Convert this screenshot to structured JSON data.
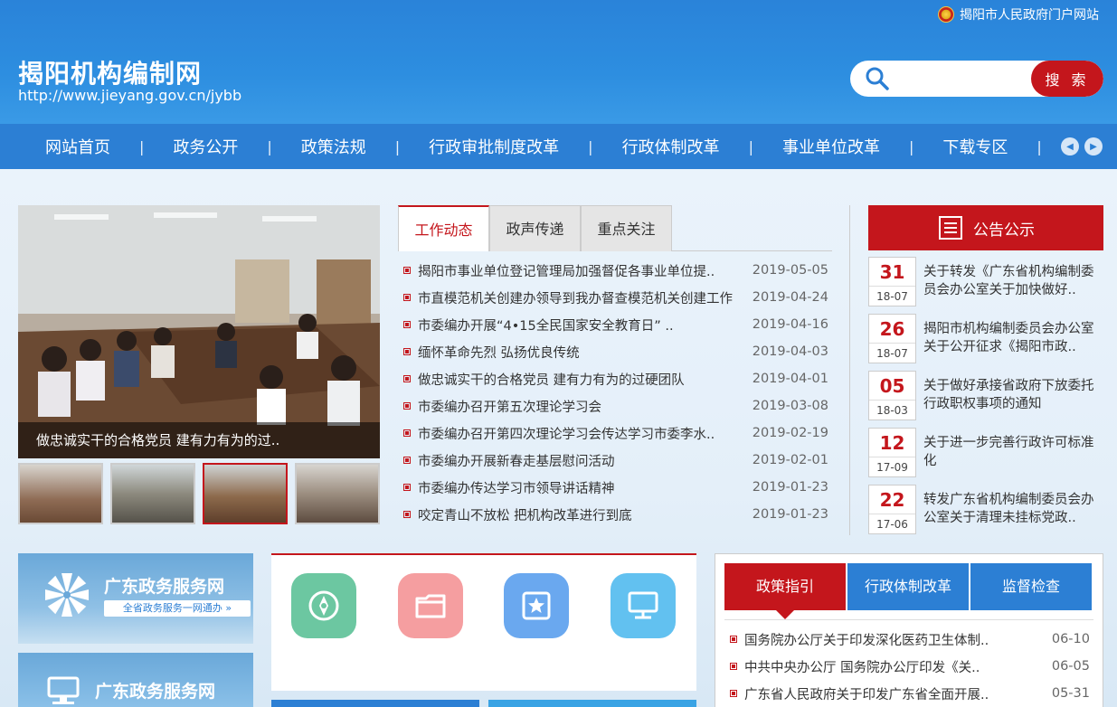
{
  "header": {
    "portal_link": "揭阳市人民政府门户网站",
    "site_title": "揭阳机构编制网",
    "site_url": "http://www.jieyang.gov.cn/jybb",
    "search_placeholder": "",
    "search_button": "搜 索"
  },
  "nav": {
    "items": [
      "网站首页",
      "政务公开",
      "政策法规",
      "行政审批制度改革",
      "行政体制改革",
      "事业单位改革",
      "下载专区"
    ],
    "separator": "|"
  },
  "slider": {
    "caption": "做忠诚实干的合格党员 建有力有为的过.."
  },
  "news": {
    "tabs": [
      "工作动态",
      "政声传递",
      "重点关注"
    ],
    "items": [
      {
        "title": "揭阳市事业单位登记管理局加强督促各事业单位提..",
        "date": "2019-05-05"
      },
      {
        "title": "市直模范机关创建办领导到我办督查模范机关创建工作",
        "date": "2019-04-24"
      },
      {
        "title": "市委编办开展“4•15全民国家安全教育日” ..",
        "date": "2019-04-16"
      },
      {
        "title": "缅怀革命先烈 弘扬优良传统",
        "date": "2019-04-03"
      },
      {
        "title": "做忠诚实干的合格党员 建有力有为的过硬团队",
        "date": "2019-04-01"
      },
      {
        "title": "市委编办召开第五次理论学习会",
        "date": "2019-03-08"
      },
      {
        "title": "市委编办召开第四次理论学习会传达学习市委李水..",
        "date": "2019-02-19"
      },
      {
        "title": "市委编办开展新春走基层慰问活动",
        "date": "2019-02-01"
      },
      {
        "title": "市委编办传达学习市领导讲话精神",
        "date": "2019-01-23"
      },
      {
        "title": "咬定青山不放松 把机构改革进行到底",
        "date": "2019-01-23"
      }
    ]
  },
  "notice": {
    "title": "公告公示",
    "items": [
      {
        "day": "31",
        "month": "18-07",
        "text": "关于转发《广东省机构编制委员会办公室关于加快做好.."
      },
      {
        "day": "26",
        "month": "18-07",
        "text": "揭阳市机构编制委员会办公室关于公开征求《揭阳市政.."
      },
      {
        "day": "05",
        "month": "18-03",
        "text": "关于做好承接省政府下放委托行政职权事项的通知"
      },
      {
        "day": "12",
        "month": "17-09",
        "text": "关于进一步完善行政许可标准化"
      },
      {
        "day": "22",
        "month": "17-06",
        "text": "转发广东省机构编制委员会办公室关于清理未挂标党政.."
      }
    ]
  },
  "banners": {
    "b1_title": "广东政务服务网",
    "b1_sub": "全省政务服务一网通办 »",
    "b2_title": "广东政务服务网"
  },
  "policy": {
    "tabs": [
      "政策指引",
      "行政体制改革",
      "监督检查"
    ],
    "items": [
      {
        "title": "国务院办公厅关于印发深化医药卫生体制..",
        "date": "06-10"
      },
      {
        "title": "中共中央办公厅 国务院办公厅印发《关..",
        "date": "06-05"
      },
      {
        "title": "广东省人民政府关于印发广东省全面开展..",
        "date": "05-31"
      }
    ]
  },
  "colors": {
    "header_blue": "#2d8ee0",
    "nav_blue": "#2c7fd4",
    "accent_red": "#c4161c"
  }
}
